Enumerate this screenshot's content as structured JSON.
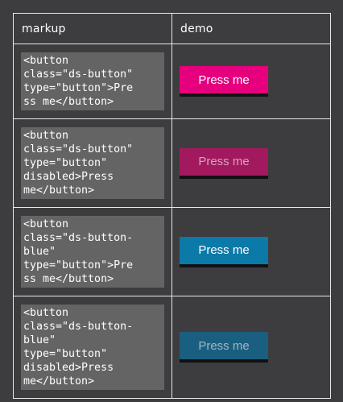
{
  "table": {
    "headers": [
      "markup",
      "demo"
    ],
    "rows": [
      {
        "markup": "<button\nclass=\"ds-button\"\ntype=\"button\">Pre\nss me</button>",
        "button_label": "Press me"
      },
      {
        "markup": "<button\nclass=\"ds-button\"\ntype=\"button\"\ndisabled>Press\nme</button>",
        "button_label": "Press me"
      },
      {
        "markup": "<button\nclass=\"ds-button-\nblue\"\ntype=\"button\">Pre\nss me</button>",
        "button_label": "Press me"
      },
      {
        "markup": "<button\nclass=\"ds-button-\nblue\"\ntype=\"button\"\ndisabled>Press\nme</button>",
        "button_label": "Press me"
      }
    ]
  },
  "colors": {
    "background": "#3d3d3f",
    "pink": "#e6007e",
    "pink_disabled": "#a3195f",
    "blue": "#0c7aa8",
    "blue_disabled": "#1a5f80",
    "code_bg": "#646464"
  }
}
